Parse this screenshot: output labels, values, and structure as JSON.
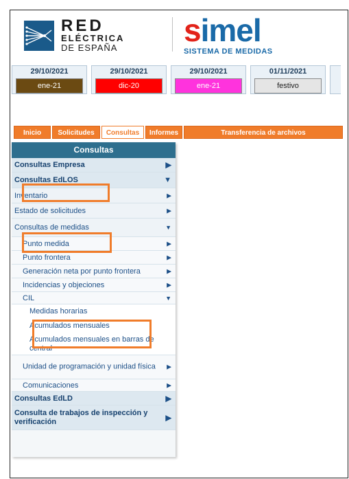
{
  "header": {
    "ree": {
      "line1": "RED",
      "line2": "ELÉCTRICA",
      "line3": "DE ESPAÑA"
    },
    "simel": {
      "word_s": "s",
      "word_rest": "imel",
      "subtitle": "SISTEMA DE MEDIDAS"
    }
  },
  "status": [
    {
      "date": "29/10/2021",
      "label": "ene-21",
      "color": "#6b4a12",
      "text_color": "#ffffff"
    },
    {
      "date": "29/10/2021",
      "label": "dic-20",
      "color": "#ff0000",
      "text_color": "#ffffff"
    },
    {
      "date": "29/10/2021",
      "label": "ene-21",
      "color": "#ff33dd",
      "text_color": "#ffffff"
    },
    {
      "date": "01/11/2021",
      "label": "festivo",
      "color": "#e5e5e5",
      "text_color": "#222222"
    }
  ],
  "tabs": [
    "Inicio",
    "Solicitudes",
    "Consultas",
    "Informes",
    "Transferencia de archivos"
  ],
  "tabs_active": "Consultas",
  "sidebar": {
    "title": "Consultas",
    "items": [
      "Consultas Empresa",
      "Consultas EdLOS",
      "Inventario",
      "Estado de solicitudes",
      "Consultas de medidas",
      "Punto medida",
      "Punto frontera",
      "Generación neta por punto frontera",
      "Incidencias y objeciones",
      "CIL",
      "Medidas horarias",
      "Acumulados mensuales",
      "Acumulados mensuales en barras de central",
      "Unidad de programación y unidad física",
      "Comunicaciones",
      "Consultas EdLD",
      "Consulta de trabajos de inspección y verificación"
    ]
  },
  "colors": {
    "highlight": "#f07c2a",
    "tab": "#f07c2a",
    "sidebar_header": "#2e6f8e"
  }
}
